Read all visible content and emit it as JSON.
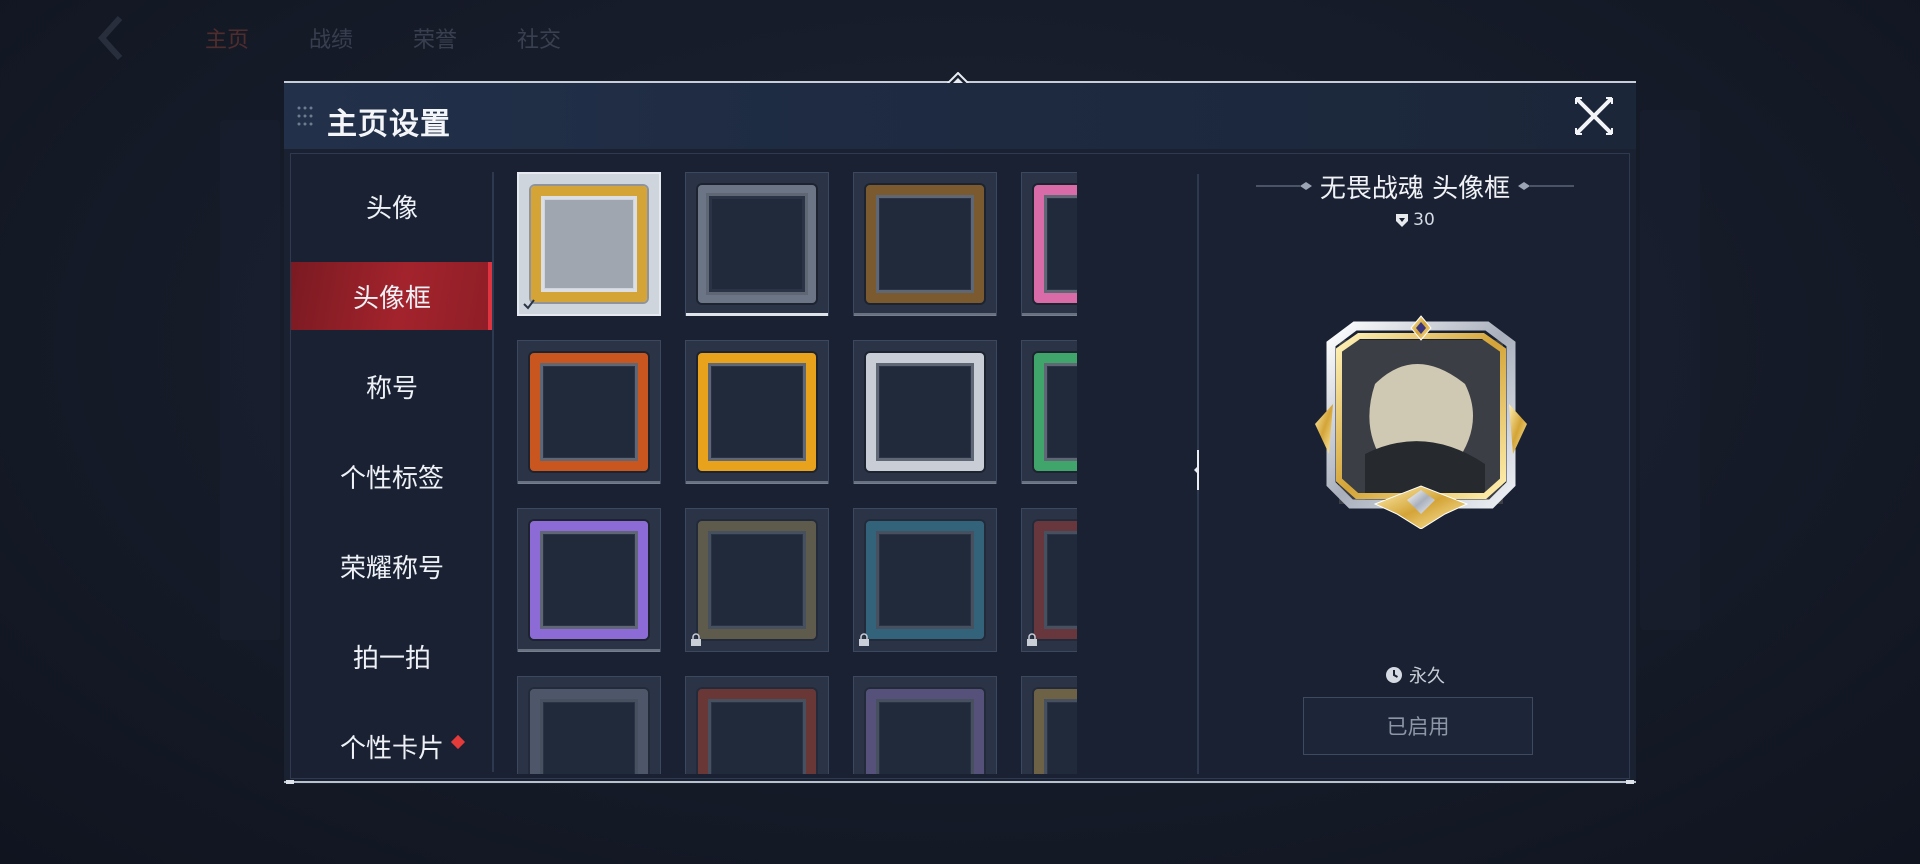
{
  "background": {
    "tabs": [
      "主页",
      "战绩",
      "荣誉",
      "社交"
    ]
  },
  "modal": {
    "title": "主页设置",
    "close_icon": "close-x-icon"
  },
  "nav": {
    "items": [
      {
        "label": "头像",
        "active": false
      },
      {
        "label": "头像框",
        "active": true
      },
      {
        "label": "称号",
        "active": false
      },
      {
        "label": "个性标签",
        "active": false
      },
      {
        "label": "荣耀称号",
        "active": false
      },
      {
        "label": "拍一拍",
        "active": false
      },
      {
        "label": "个性卡片",
        "active": false,
        "badge": true
      }
    ]
  },
  "grid": {
    "frames": [
      {
        "name": "gold-crown-frame",
        "selected": true,
        "locked": false,
        "color": "#d4a437"
      },
      {
        "name": "default-frame",
        "selected": false,
        "locked": false,
        "color": "#6b7585"
      },
      {
        "name": "wood-vine-frame",
        "selected": false,
        "locked": false,
        "color": "#7a5a2e"
      },
      {
        "name": "flower-butterfly-frame",
        "selected": false,
        "locked": false,
        "color": "#d96ba8"
      },
      {
        "name": "lantern-festival-frame",
        "selected": false,
        "locked": false,
        "color": "#c9561f"
      },
      {
        "name": "fire-2026-frame",
        "selected": false,
        "locked": false,
        "color": "#e8a21c"
      },
      {
        "name": "silver-red-gem-frame",
        "selected": false,
        "locked": false,
        "color": "#c9cdd6"
      },
      {
        "name": "silver-green-gem-frame",
        "selected": false,
        "locked": false,
        "color": "#3fa56b"
      },
      {
        "name": "purple-gem-frame",
        "selected": false,
        "locked": false,
        "color": "#8d6bd6"
      },
      {
        "name": "scroll-ink-frame",
        "selected": false,
        "locked": true,
        "color": "#8a7a52"
      },
      {
        "name": "wave-dragon-frame",
        "selected": false,
        "locked": true,
        "color": "#3b8aa6"
      },
      {
        "name": "red-bronze-frame",
        "selected": false,
        "locked": true,
        "color": "#9a3a36"
      },
      {
        "name": "silver-curtain-frame",
        "selected": false,
        "locked": true,
        "color": "#6c7386"
      },
      {
        "name": "crimson-ornate-frame",
        "selected": false,
        "locked": true,
        "color": "#9b3a2a"
      },
      {
        "name": "violet-drape-frame",
        "selected": false,
        "locked": true,
        "color": "#7a6aa8"
      },
      {
        "name": "golden-lantern-frame",
        "selected": false,
        "locked": true,
        "color": "#a48845"
      }
    ]
  },
  "detail": {
    "title": "无畏战魂 头像框",
    "score": "30",
    "duration": "永久",
    "button_label": "已启用"
  }
}
